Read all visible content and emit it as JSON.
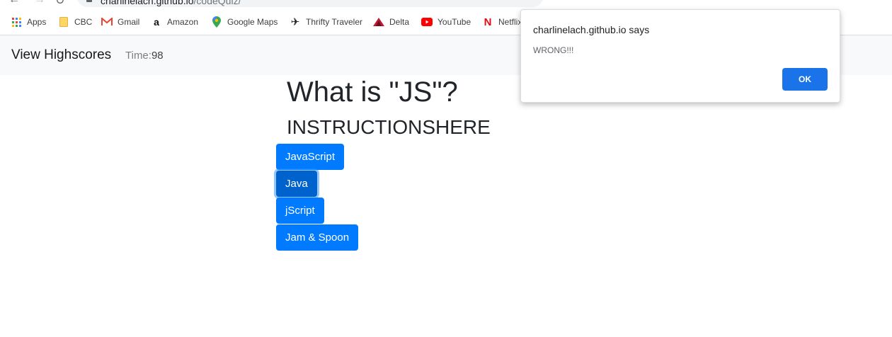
{
  "browser": {
    "url_host": "charlinelach.github.io",
    "url_path": "/codeQuiz/",
    "bookmarks": [
      {
        "label": "Apps",
        "icon": "apps-grid-icon"
      },
      {
        "label": "CBC",
        "icon": "folder-icon"
      },
      {
        "label": "Gmail",
        "icon": "gmail-icon"
      },
      {
        "label": "Amazon",
        "icon": "amazon-icon"
      },
      {
        "label": "Google Maps",
        "icon": "map-pin-icon"
      },
      {
        "label": "Thrifty Traveler",
        "icon": "airplane-icon"
      },
      {
        "label": "Delta",
        "icon": "delta-icon"
      },
      {
        "label": "YouTube",
        "icon": "youtube-icon"
      },
      {
        "label": "Netflix",
        "icon": "netflix-icon"
      }
    ]
  },
  "navbar": {
    "brand": "View Highscores",
    "time_label": "Time:",
    "time_value": "98"
  },
  "quiz": {
    "question": "What is \"JS\"?",
    "instructions": "INSTRUCTIONSHERE",
    "answers": [
      "JavaScript",
      "Java",
      "jScript",
      "Jam & Spoon"
    ],
    "focused_answer": "Java"
  },
  "dialog": {
    "title": "charlinelach.github.io says",
    "message": "WRONG!!!",
    "ok_label": "OK"
  },
  "colors": {
    "primary_button": "#007bff",
    "focused_button": "#0062cc",
    "dialog_ok": "#1a73e8",
    "navbar_bg": "#f8f9fa"
  }
}
